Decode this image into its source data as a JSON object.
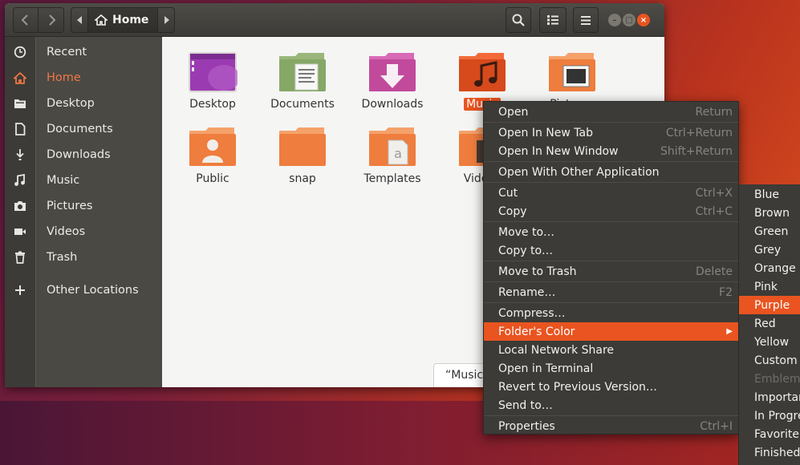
{
  "window": {
    "path": {
      "current": "Home"
    },
    "controls": {
      "minimize": "–",
      "maximize": "□",
      "close": "×"
    }
  },
  "sidebar": {
    "items": [
      {
        "label": "Recent",
        "icon": "clock-icon"
      },
      {
        "label": "Home",
        "icon": "home-icon",
        "active": true
      },
      {
        "label": "Desktop",
        "icon": "folder-icon"
      },
      {
        "label": "Documents",
        "icon": "document-icon"
      },
      {
        "label": "Downloads",
        "icon": "download-icon"
      },
      {
        "label": "Music",
        "icon": "music-icon"
      },
      {
        "label": "Pictures",
        "icon": "camera-icon"
      },
      {
        "label": "Videos",
        "icon": "video-icon"
      },
      {
        "label": "Trash",
        "icon": "trash-icon"
      },
      {
        "label": "Other Locations",
        "icon": "plus-icon"
      }
    ]
  },
  "files": [
    {
      "name": "Desktop",
      "icon": "desktop-folder-icon"
    },
    {
      "name": "Documents",
      "icon": "documents-folder-icon"
    },
    {
      "name": "Downloads",
      "icon": "downloads-folder-icon"
    },
    {
      "name": "Music",
      "icon": "music-folder-icon",
      "selected": true
    },
    {
      "name": "Pictures",
      "icon": "pictures-folder-icon"
    },
    {
      "name": "Public",
      "icon": "public-folder-icon"
    },
    {
      "name": "snap",
      "icon": "folder-icon"
    },
    {
      "name": "Templates",
      "icon": "templates-folder-icon"
    },
    {
      "name": "Videos",
      "icon": "videos-folder-icon"
    }
  ],
  "status": {
    "text": "“Music” selected"
  },
  "context_menu": {
    "items": [
      {
        "label": "Open",
        "accel": "Return"
      },
      {
        "label": "Open In New Tab",
        "accel": "Ctrl+Return"
      },
      {
        "label": "Open In New Window",
        "accel": "Shift+Return"
      },
      {
        "label": "Open With Other Application",
        "accel": ""
      },
      {
        "label": "Cut",
        "accel": "Ctrl+X"
      },
      {
        "label": "Copy",
        "accel": "Ctrl+C"
      },
      {
        "label": "Move to…",
        "accel": ""
      },
      {
        "label": "Copy to…",
        "accel": ""
      },
      {
        "label": "Move to Trash",
        "accel": "Delete"
      },
      {
        "label": "Rename…",
        "accel": "F2"
      },
      {
        "label": "Compress…",
        "accel": ""
      },
      {
        "label": "Folder's Color",
        "accel": "",
        "highlighted": true,
        "submenu": true
      },
      {
        "label": "Local Network Share",
        "accel": ""
      },
      {
        "label": "Open in Terminal",
        "accel": ""
      },
      {
        "label": "Revert to Previous Version…",
        "accel": ""
      },
      {
        "label": "Send to…",
        "accel": ""
      },
      {
        "label": "Properties",
        "accel": "Ctrl+I"
      }
    ]
  },
  "color_submenu": {
    "items": [
      {
        "label": "Blue"
      },
      {
        "label": "Brown"
      },
      {
        "label": "Green"
      },
      {
        "label": "Grey"
      },
      {
        "label": "Orange"
      },
      {
        "label": "Pink"
      },
      {
        "label": "Purple",
        "highlighted": true
      },
      {
        "label": "Red"
      },
      {
        "label": "Yellow"
      },
      {
        "label": "Custom"
      },
      {
        "label": "Emblem:",
        "disabled": true
      },
      {
        "label": "Important"
      },
      {
        "label": "In Progress"
      },
      {
        "label": "Favorite"
      },
      {
        "label": "Finished"
      }
    ]
  },
  "colors": {
    "accent": "#e95420",
    "headerbar": "#3d3b37",
    "menu_bg": "#3c3b37"
  }
}
